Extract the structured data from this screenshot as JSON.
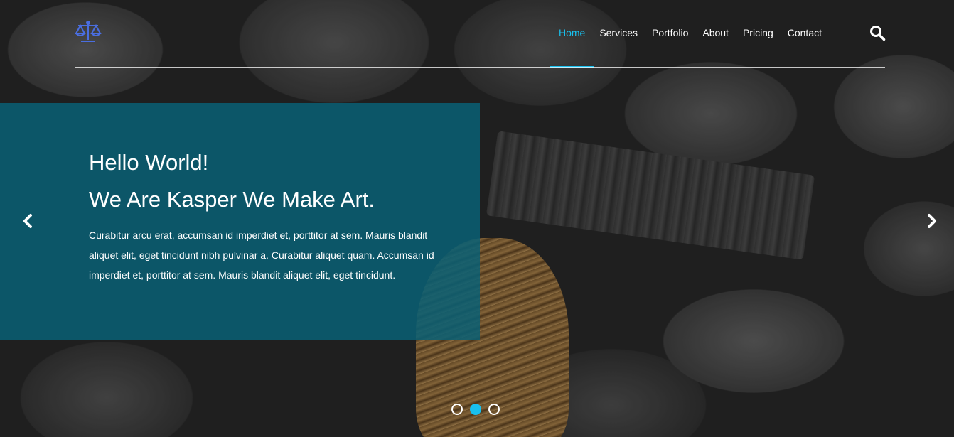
{
  "header": {
    "logo_icon": "balance-scale-icon",
    "accent_color": "#19c0ee",
    "nav": [
      {
        "label": "Home",
        "active": true
      },
      {
        "label": "Services",
        "active": false
      },
      {
        "label": "Portfolio",
        "active": false
      },
      {
        "label": "About",
        "active": false
      },
      {
        "label": "Pricing",
        "active": false
      },
      {
        "label": "Contact",
        "active": false
      }
    ],
    "search_icon": "search-icon"
  },
  "slider": {
    "caption": {
      "line1": "Hello World!",
      "line2": "We Are Kasper We Make Art.",
      "text": "Curabitur arcu erat, accumsan id imperdiet et, porttitor at sem. Mauris blandit aliquet elit, eget tincidunt nibh pulvinar a. Curabitur aliquet quam. Accumsan id imperdiet et, porttitor at sem. Mauris blandit aliquet elit, eget tincidunt."
    },
    "caption_bg": "#096075",
    "prev_icon": "chevron-left-icon",
    "next_icon": "chevron-right-icon",
    "indicators": [
      {
        "active": false
      },
      {
        "active": true
      },
      {
        "active": false
      }
    ]
  }
}
